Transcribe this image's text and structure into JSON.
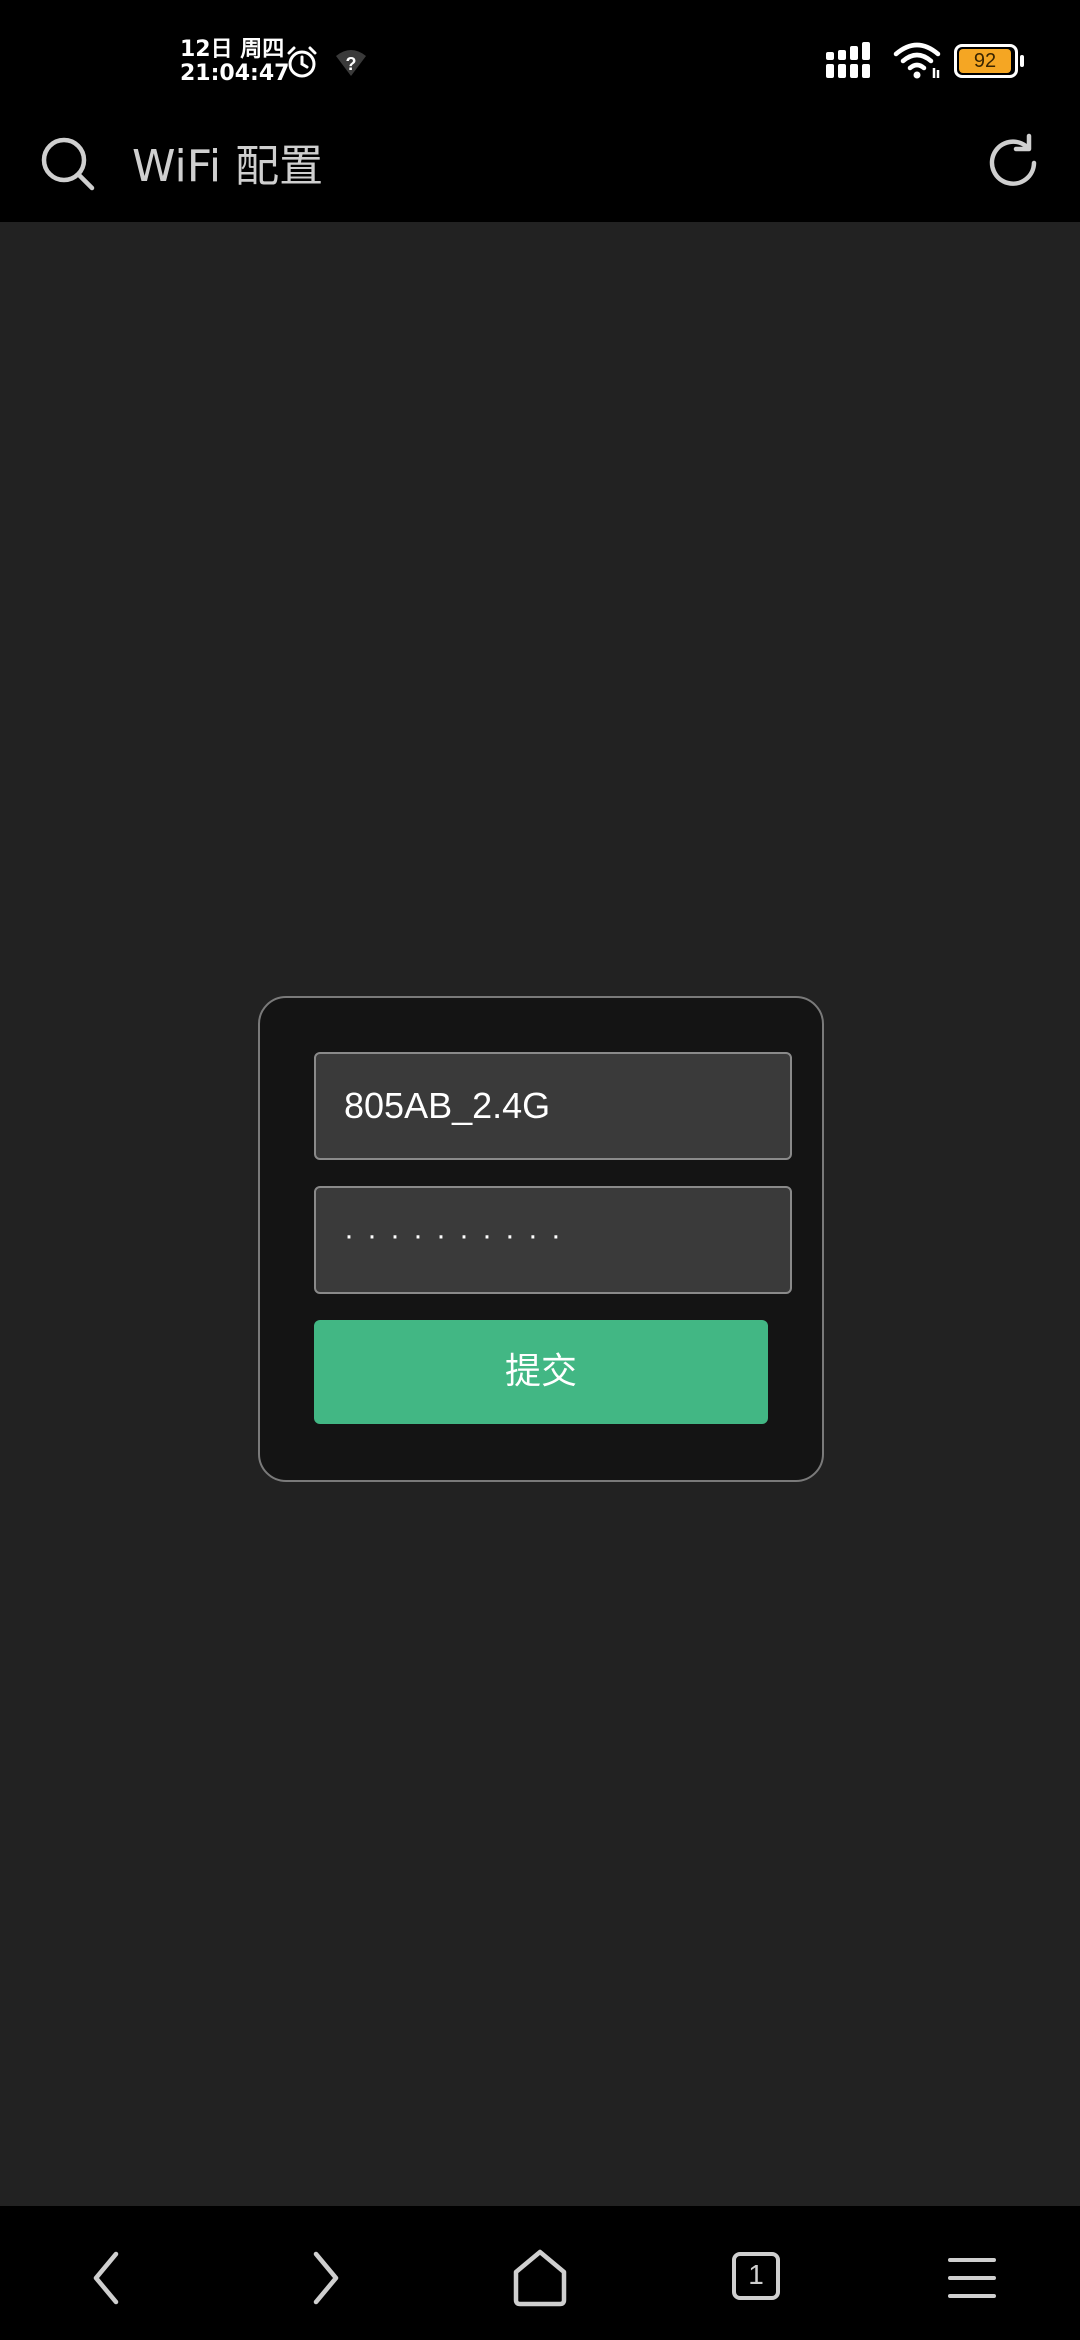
{
  "status_bar": {
    "date": "12日 周四",
    "time": "21:04:47",
    "battery": "92",
    "icons": [
      "alarm-icon",
      "wifi-question-icon",
      "signal-icon",
      "wifi-icon",
      "battery-icon"
    ],
    "battery_color": "#f5a623"
  },
  "header": {
    "title": "WiFi 配置",
    "icons": [
      "search-icon",
      "refresh-icon"
    ]
  },
  "form": {
    "ssid_value": "805AB_2.4G",
    "password_value": "··········",
    "submit_label": "提交"
  },
  "bottom_nav": {
    "tab_count": "1",
    "icons": [
      "back-icon",
      "forward-icon",
      "home-icon",
      "tabs-icon",
      "menu-icon"
    ]
  },
  "colors": {
    "accent": "#42b784",
    "background": "#222222",
    "card": "#141414"
  }
}
